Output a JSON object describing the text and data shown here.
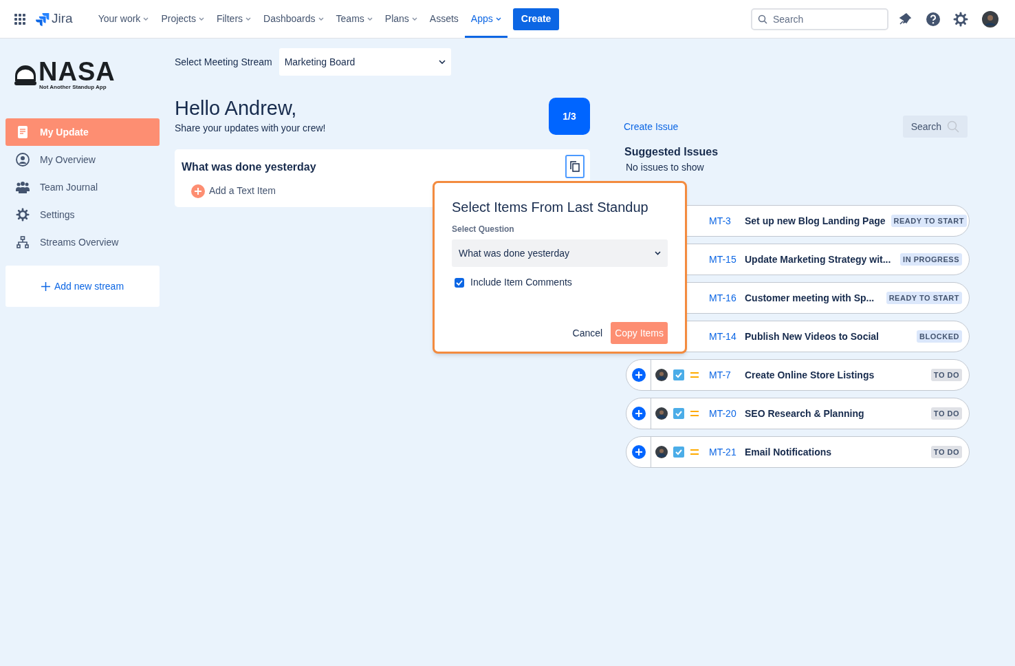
{
  "topbar": {
    "product": "Jira",
    "nav": [
      {
        "label": "Your work",
        "dropdown": true,
        "selected": false
      },
      {
        "label": "Projects",
        "dropdown": true,
        "selected": false
      },
      {
        "label": "Filters",
        "dropdown": true,
        "selected": false
      },
      {
        "label": "Dashboards",
        "dropdown": true,
        "selected": false
      },
      {
        "label": "Teams",
        "dropdown": true,
        "selected": false
      },
      {
        "label": "Plans",
        "dropdown": true,
        "selected": false
      },
      {
        "label": "Assets",
        "dropdown": false,
        "selected": false
      },
      {
        "label": "Apps",
        "dropdown": true,
        "selected": true
      }
    ],
    "create_button": "Create",
    "search": {
      "placeholder": "Search"
    }
  },
  "logo": {
    "wordmark": "NASA",
    "tagline": "Not Another Standup App"
  },
  "sidebar": {
    "items": [
      {
        "label": "My Update",
        "kind": "document",
        "selected": true
      },
      {
        "label": "My Overview",
        "kind": "person",
        "selected": false
      },
      {
        "label": "Team Journal",
        "kind": "people",
        "selected": false
      },
      {
        "label": "Settings",
        "kind": "gear",
        "selected": false
      },
      {
        "label": "Streams Overview",
        "kind": "hierarchy",
        "selected": false
      }
    ],
    "add_stream": "Add new stream"
  },
  "stream_select": {
    "label": "Select Meeting Stream",
    "value": "Marketing Board"
  },
  "greeting": {
    "title": "Hello Andrew,",
    "subtitle": "Share your updates with your crew!",
    "counter": "1/3"
  },
  "question_card": {
    "title": "What was done yesterday",
    "add_item": "Add a Text Item"
  },
  "issues_panel": {
    "create_link": "Create Issue",
    "search_button": "Search",
    "suggested_title": "Suggested Issues",
    "empty_text": "No issues to show",
    "issues": [
      {
        "kind": "covered",
        "key": "MT-3",
        "summary": "Set up new Blog Landing Page",
        "status": "READY TO START",
        "color": "#dbe7fb"
      },
      {
        "kind": "covered",
        "key": "MT-15",
        "summary": "Update Marketing Strategy wit...",
        "status": "IN PROGRESS",
        "color": "#dbe7fb"
      },
      {
        "kind": "covered",
        "key": "MT-16",
        "summary": "Customer meeting with Sp...",
        "status": "READY TO START",
        "color": "#dbe7fb"
      },
      {
        "kind": "covered",
        "key": "MT-14",
        "summary": "Publish New Videos to Social",
        "status": "BLOCKED",
        "color": "#dbe7fb"
      },
      {
        "kind": "full",
        "key": "MT-7",
        "summary": "Create Online Store Listings",
        "status": "TO DO",
        "color": "#dfe1e6"
      },
      {
        "kind": "full",
        "key": "MT-20",
        "summary": "SEO Research & Planning",
        "status": "TO DO",
        "color": "#dfe1e6"
      },
      {
        "kind": "full",
        "key": "MT-21",
        "summary": "Email Notifications",
        "status": "TO DO",
        "color": "#dfe1e6"
      }
    ]
  },
  "dialog": {
    "title": "Select Items From Last Standup",
    "field_label": "Select Question",
    "question": "What was done yesterday",
    "include_comments": {
      "label": "Include Item Comments",
      "checked": true
    },
    "cancel": "Cancel",
    "confirm": "Copy Items"
  }
}
